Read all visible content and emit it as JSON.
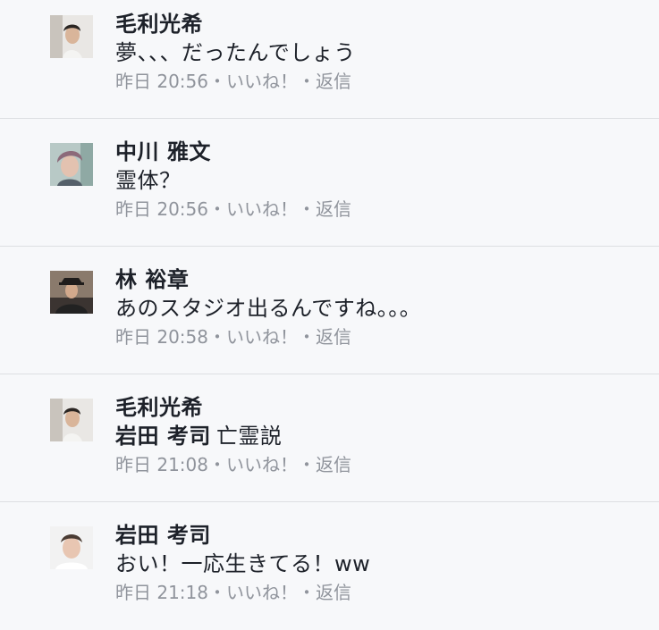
{
  "comments": [
    {
      "author": "毛利光希",
      "tag": "",
      "text": "夢、、、だったんでしょう",
      "time": "昨日 20:56",
      "like": "いいね！",
      "reply": "返信",
      "sep1": "・",
      "sep2": "・"
    },
    {
      "author": "中川 雅文",
      "tag": "",
      "text": "霊体？",
      "time": "昨日 20:56",
      "like": "いいね！",
      "reply": "返信",
      "sep1": "・",
      "sep2": "・"
    },
    {
      "author": "林 裕章",
      "tag": "",
      "text": "あのスタジオ出るんですね。。。",
      "time": "昨日 20:58",
      "like": "いいね！",
      "reply": "返信",
      "sep1": "・",
      "sep2": "・"
    },
    {
      "author": "毛利光希",
      "tag": "岩田 考司",
      "text": "亡霊説",
      "time": "昨日 21:08",
      "like": "いいね！",
      "reply": "返信",
      "sep1": "・",
      "sep2": "・"
    },
    {
      "author": "岩田 考司",
      "tag": "",
      "text": "おい！一応生きてる！ww",
      "time": "昨日 21:18",
      "like": "いいね！",
      "reply": "返信",
      "sep1": "・",
      "sep2": "・"
    }
  ]
}
